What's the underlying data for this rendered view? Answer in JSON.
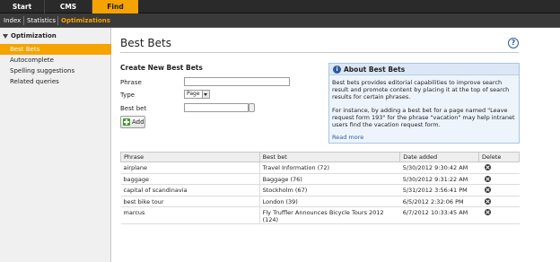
{
  "topnav": {
    "tabs": [
      "Start",
      "CMS",
      "Find"
    ],
    "active": "Find"
  },
  "subnav": {
    "items": [
      "Index",
      "Statistics",
      "Optimizations"
    ],
    "active": "Optimizations"
  },
  "sidebar": {
    "group": "Optimization",
    "items": [
      {
        "label": "Best Bets",
        "active": true
      },
      {
        "label": "Autocomplete"
      },
      {
        "label": "Spelling suggestions"
      },
      {
        "label": "Related queries"
      }
    ]
  },
  "main": {
    "title": "Best Bets",
    "form": {
      "heading": "Create New Best Bets",
      "phrase_label": "Phrase",
      "type_label": "Type",
      "type_value": "Page",
      "bestbet_label": "Best bet",
      "add_label": "Add"
    },
    "about": {
      "heading": "About Best Bets",
      "p1": "Best bets provides editorial capabilities to improve search result and promote content by placing it at the top of search results for certain phrases.",
      "p2": "For instance, by adding a best bet for a page named \"Leave request form 193\" for the phrase \"vacation\" may help intranet users find the vacation request form.",
      "more": "Read more"
    },
    "table": {
      "headers": [
        "Phrase",
        "Best bet",
        "Date added",
        "Delete"
      ],
      "rows": [
        {
          "phrase": "airplane",
          "bestbet": "Travel Information (72)",
          "date": "5/30/2012 9:30:42 AM"
        },
        {
          "phrase": "baggage",
          "bestbet": "Baggage (76)",
          "date": "5/30/2012 9:31:22 AM"
        },
        {
          "phrase": "capital of scandinavia",
          "bestbet": "Stockholm (67)",
          "date": "5/31/2012 3:56:41 PM"
        },
        {
          "phrase": "best bike tour",
          "bestbet": "London (39)",
          "date": "6/5/2012 2:32:06 PM"
        },
        {
          "phrase": "marcus",
          "bestbet": "Fly Truffler Announces Bicycle Tours 2012 (124)",
          "date": "6/7/2012 10:33:45 AM"
        }
      ]
    }
  },
  "colors": {
    "accent": "#f5a300",
    "topbar": "#2a2a2a",
    "link": "#2d5c9c"
  }
}
